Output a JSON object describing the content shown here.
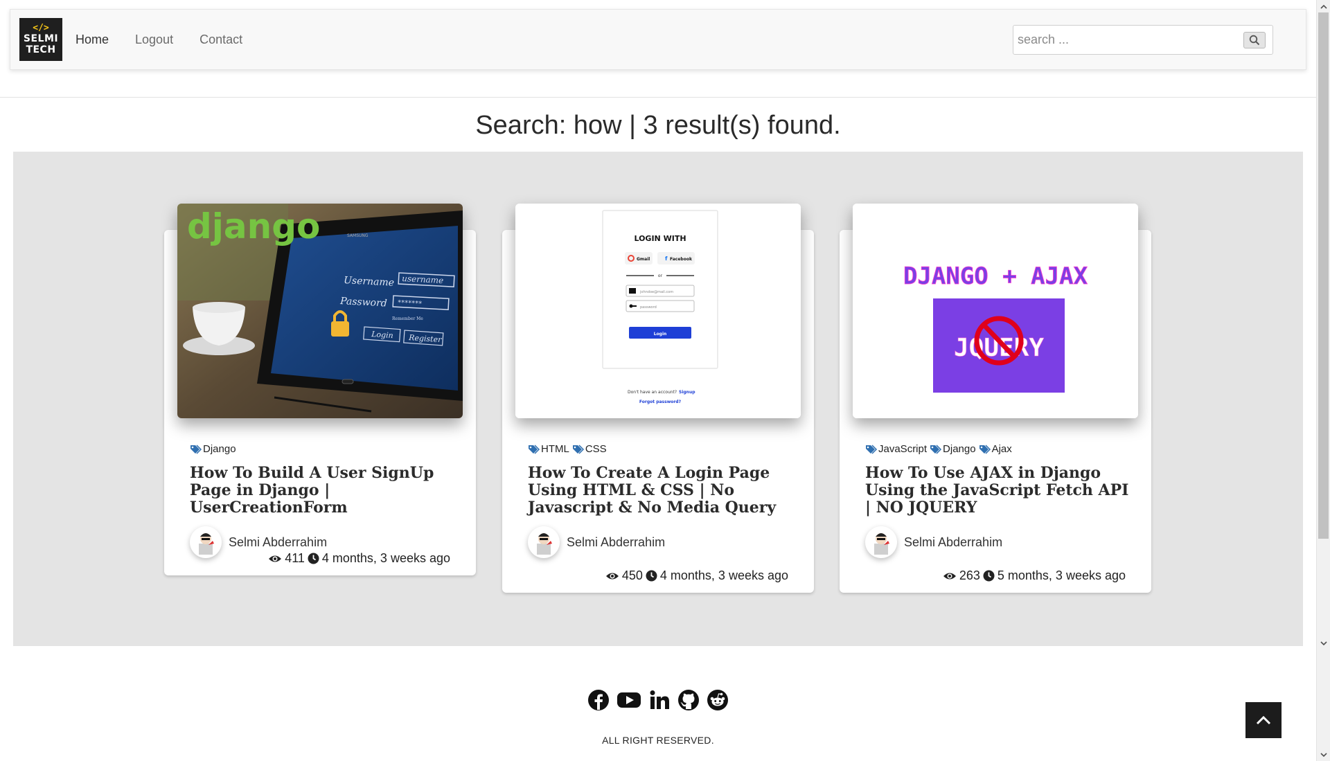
{
  "window": {
    "title": "Search: how"
  },
  "brand": {
    "code": "</>",
    "line1": "SELMI",
    "line2": "TECH"
  },
  "nav": {
    "links": [
      {
        "label": "Home",
        "active": true
      },
      {
        "label": "Logout",
        "active": false
      },
      {
        "label": "Contact",
        "active": false
      }
    ]
  },
  "search": {
    "placeholder": "search ...",
    "value": "",
    "button_icon": "search-icon"
  },
  "page": {
    "title": "Search: how | 3 result(s) found."
  },
  "results": [
    {
      "thumb": {
        "logo": "django",
        "username_label": "Username",
        "username_placeholder": "username",
        "password_label": "Password",
        "password_value": "*******",
        "remember": "Remember Me",
        "login": "Login",
        "register": "Register",
        "brand": "SAMSUNG"
      },
      "tags": [
        "Django"
      ],
      "title": "How To Build A User SignUp Page in Django | UserCreationForm",
      "author": "Selmi Abderrahim",
      "views": "411",
      "time": "4 months, 3 weeks ago"
    },
    {
      "thumb": {
        "heading": "LOGIN WITH",
        "gmail": "Gmail",
        "facebook": "Facebook",
        "or": "or",
        "email_placeholder": "johndoe@mail.com",
        "password_placeholder": "password",
        "login": "Login",
        "no_account": "Don't have an account?",
        "signup": "Signup",
        "forgot": "Forgot password?"
      },
      "tags": [
        "HTML",
        "CSS"
      ],
      "title": "How To Create A Login Page Using HTML & CSS | No Javascript & No Media Query",
      "author": "Selmi Abderrahim",
      "views": "450",
      "time": "4 months, 3 weeks ago"
    },
    {
      "thumb": {
        "heading": "DJANGO + AJAX",
        "sub": "JQUERY"
      },
      "tags": [
        "JavaScript",
        "Django",
        "Ajax"
      ],
      "title": "How To Use AJAX in Django Using the JavaScript Fetch API | NO JQUERY",
      "author": "Selmi Abderrahim",
      "views": "263",
      "time": "5 months, 3 weeks ago"
    }
  ],
  "footer": {
    "socials": [
      "facebook-icon",
      "youtube-icon",
      "linkedin-icon",
      "github-icon",
      "reddit-icon"
    ],
    "copyright": "ALL RIGHT RESERVED."
  },
  "colors": {
    "tag_icon": "#2f6fb0",
    "django_green": "#44b78b",
    "ajax_purple": "#7b3fe4",
    "result_bg": "#e4e4e4"
  }
}
